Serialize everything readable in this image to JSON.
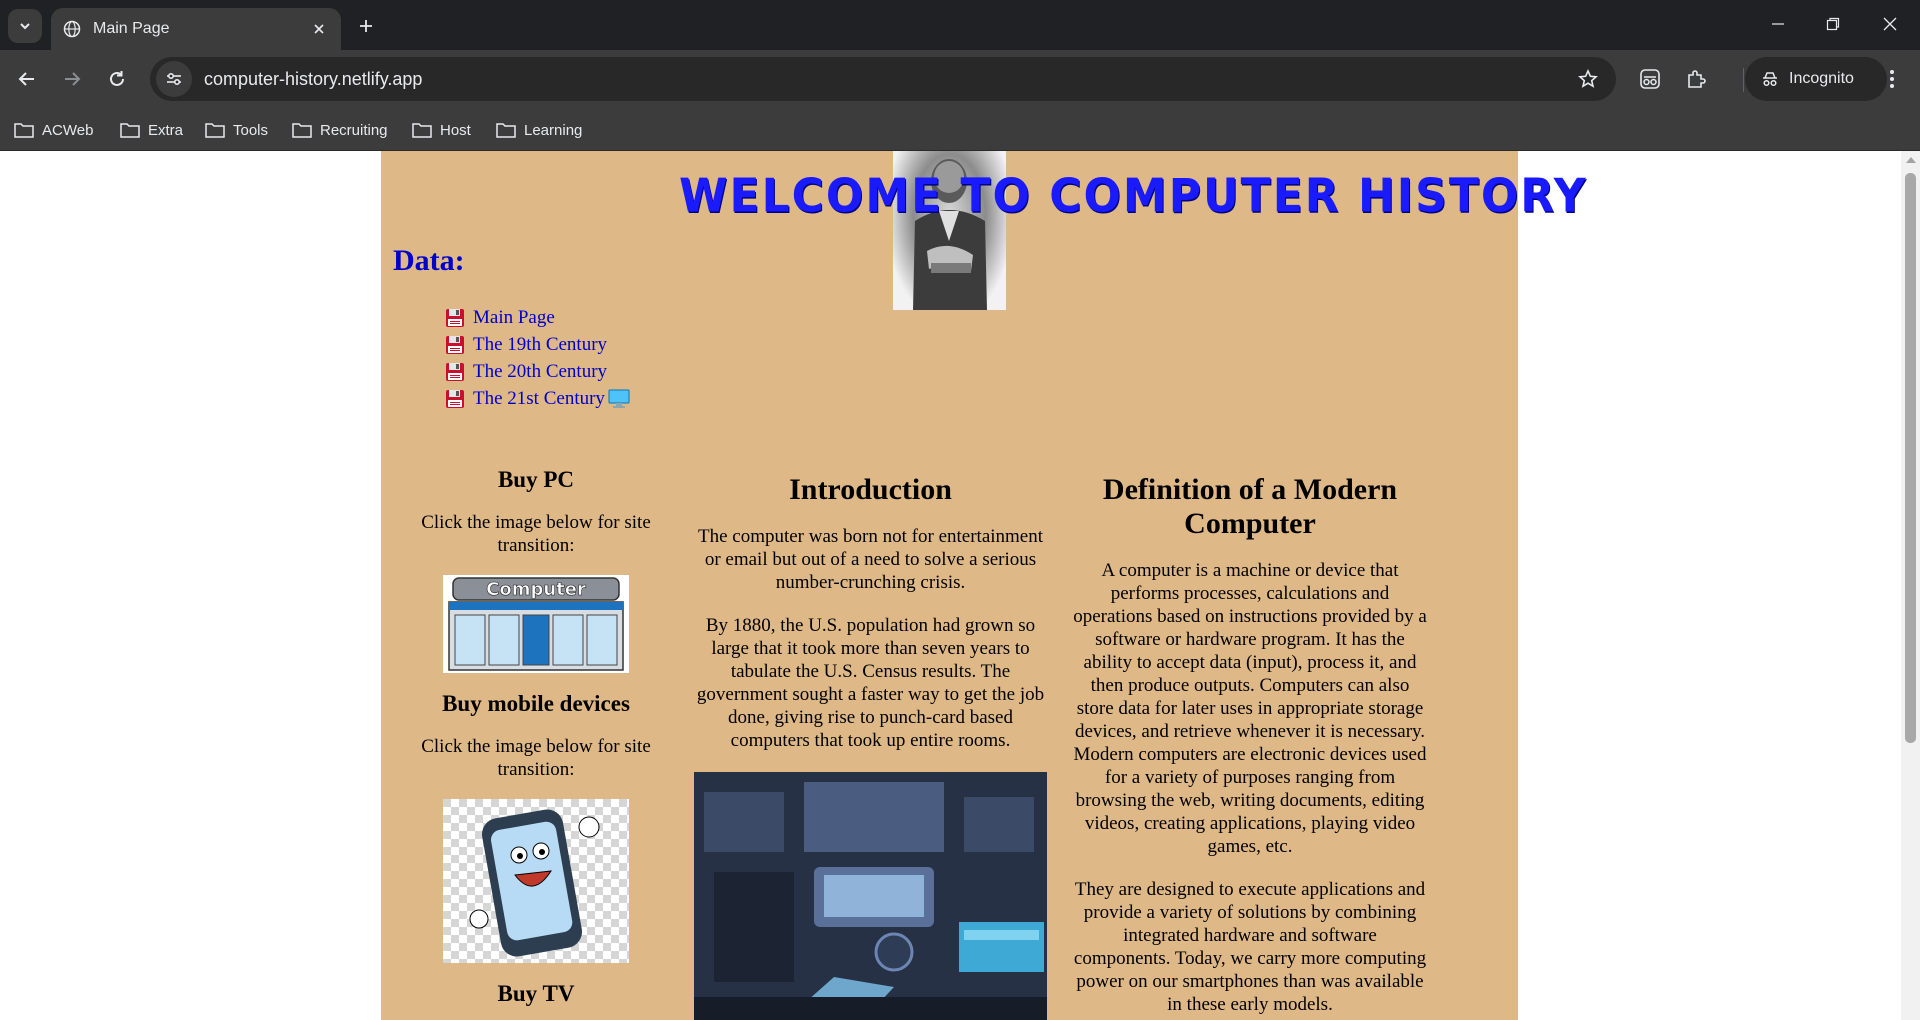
{
  "browser": {
    "tab_title": "Main Page",
    "url": "computer-history.netlify.app",
    "incognito_label": "Incognito",
    "bookmarks": [
      "ACWeb",
      "Extra",
      "Tools",
      "Recruiting",
      "Host",
      "Learning"
    ]
  },
  "page": {
    "header_title": "WELCOME TO COMPUTER HISTORY",
    "data_heading": "Data:",
    "nav": [
      "Main Page",
      "The 19th Century",
      "The 20th Century",
      "The 21st Century"
    ],
    "left": {
      "buy_pc_title": "Buy PC",
      "buy_pc_text": "Click the image below for site transition:",
      "buy_pc_sign": "Computer",
      "buy_mobile_title": "Buy mobile devices",
      "buy_mobile_text": "Click the image below for site transition:",
      "buy_tv_title": "Buy TV"
    },
    "intro": {
      "title": "Introduction",
      "p1": "The computer was born not for entertainment or email but out of a need to solve a serious number-crunching crisis.",
      "p2": "By 1880, the U.S. population had grown so large that it took more than seven years to tabulate the U.S. Census results. The government sought a faster way to get the job done, giving rise to punch-card based computers that took up entire rooms."
    },
    "definition": {
      "title": "Definition of a Modern Computer",
      "p1": "A computer is a machine or device that performs processes, calculations and operations based on instructions provided by a software or hardware program. It has the ability to accept data (input), process it, and then produce outputs. Computers can also store data for later uses in appropriate storage devices, and retrieve whenever it is necessary. Modern computers are electronic devices used for a variety of purposes ranging from browsing the web, writing documents, editing videos, creating applications, playing video games, etc.",
      "p2": "They are designed to execute applications and provide a variety of solutions by combining integrated hardware and software components. Today, we carry more computing power on our smartphones than was available in these early models."
    },
    "colors": {
      "background": "#deb887",
      "link": "#0000cd",
      "title": "#1a1aff"
    }
  }
}
